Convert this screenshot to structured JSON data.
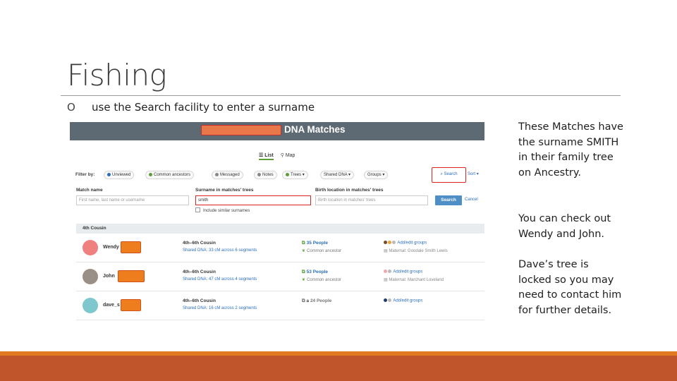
{
  "slide": {
    "title": "Fishing",
    "bullet_marker": "O",
    "bullet_text": "use the Search facility to enter a surname",
    "notes": [
      "These Matches have the surname SMITH in their family tree on Ancestry.",
      "You can check out Wendy and John.",
      "Dave’s tree is locked so you may need to contact him for further details."
    ],
    "colors": {
      "accent_stripe": "#e07b22",
      "footer_bar": "#c0552b"
    }
  },
  "screenshot": {
    "header_title": "DNA Matches",
    "views": [
      {
        "icon": "list-icon",
        "label": "List"
      },
      {
        "icon": "map-pin-icon",
        "label": "Map"
      }
    ],
    "filter_label": "Filter by:",
    "filters": [
      "Unviewed",
      "Common ancestors",
      "Messaged",
      "Notes",
      "Trees",
      "Shared DNA",
      "Groups"
    ],
    "search_label": "Search",
    "sort_label": "Sort",
    "match_name": {
      "label": "Match name",
      "placeholder": "First name, last name or username"
    },
    "surname": {
      "label": "Surname in matches' trees",
      "value": "smith"
    },
    "similar_checkbox": "Include similar surnames",
    "birth_location": {
      "label": "Birth location in matches' trees",
      "placeholder": "Birth location in matches' trees"
    },
    "search_button": "Search",
    "cancel_link": "Cancel",
    "group_heading": "4th Cousin",
    "matches": [
      {
        "name": "Wendy",
        "relationship": "4th–6th Cousin",
        "shared_dna": "Shared DNA: 33 cM across 6 segments",
        "tree": "35 People",
        "ancestor": "Common ancestor",
        "groups": "Add/edit groups",
        "note": "Maternal: Goodale Smith Lewis",
        "avatar_color": "#f08080"
      },
      {
        "name": "John",
        "relationship": "4th–6th Cousin",
        "shared_dna": "Shared DNA: 47 cM across 4 segments",
        "tree": "53 People",
        "ancestor": "Common ancestor",
        "groups": "Add/edit groups",
        "note": "Maternal: Marchant Loveland",
        "avatar_color": "#9a8f86"
      },
      {
        "name": "dave_s",
        "relationship": "4th–6th Cousin",
        "shared_dna": "Shared DNA: 16 cM across 2 segments",
        "tree": "24 People",
        "ancestor": "",
        "groups": "Add/edit groups",
        "note": "",
        "avatar_color": "#7fc7cf"
      }
    ]
  }
}
